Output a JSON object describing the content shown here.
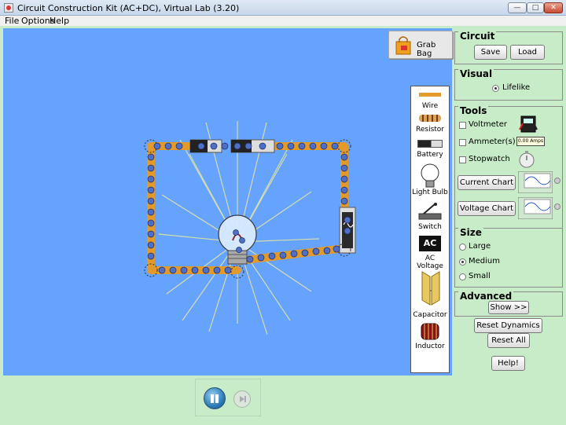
{
  "window": {
    "title": "Circuit Construction Kit (AC+DC), Virtual Lab (3.20)",
    "min_label": "—",
    "max_label": "□",
    "close_label": "✕"
  },
  "menu": {
    "file": "File",
    "options": "Options",
    "help": "Help"
  },
  "canvas": {
    "grab_bag_label": "Grab Bag",
    "background_color": "#66a3ff",
    "wire_color": "#e39a2d",
    "electron_color": "#4f6fc7"
  },
  "toolbox": {
    "wire": "Wire",
    "resistor": "Resistor",
    "battery": "Battery",
    "light_bulb": "Light Bulb",
    "switch": "Switch",
    "ac_voltage": "AC Voltage",
    "ac_icon_text": "AC",
    "capacitor": "Capacitor",
    "inductor": "Inductor"
  },
  "panels": {
    "circuit": {
      "title": "Circuit",
      "save": "Save",
      "load": "Load"
    },
    "visual": {
      "title": "Visual",
      "lifelike": "Lifelike"
    },
    "tools": {
      "title": "Tools",
      "voltmeter": "Voltmeter",
      "ammeter": "Ammeter(s)",
      "ammeter_readout": "0.00 Amps",
      "stopwatch": "Stopwatch",
      "current_chart": "Current Chart",
      "voltage_chart": "Voltage Chart"
    },
    "size": {
      "title": "Size",
      "large": "Large",
      "medium": "Medium",
      "small": "Small"
    },
    "advanced": {
      "title": "Advanced",
      "show": "Show >>"
    },
    "reset_dynamics": "Reset Dynamics",
    "reset_all": "Reset All",
    "help": "Help!"
  }
}
